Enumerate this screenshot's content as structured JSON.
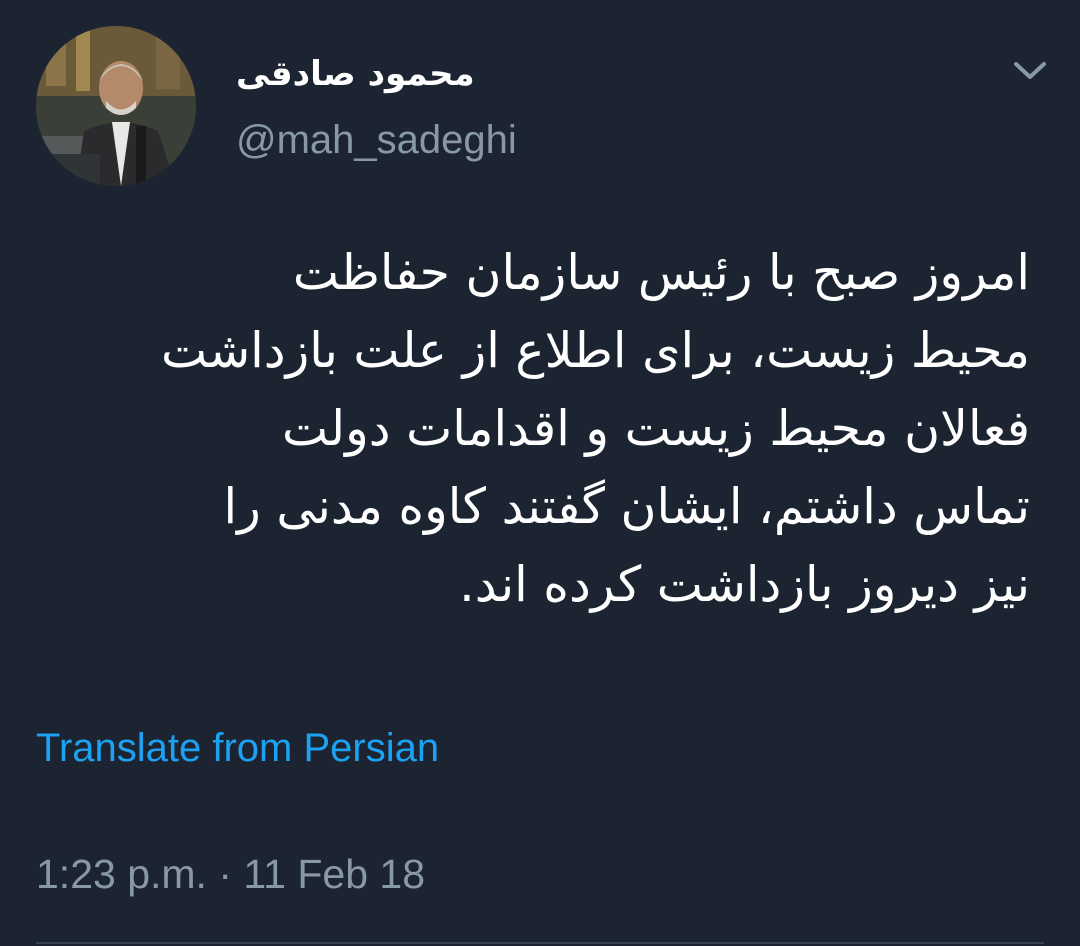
{
  "author": {
    "display_name": "محمود صادقی",
    "handle": "@mah_sadeghi",
    "avatar_icon": "profile-photo-avatar"
  },
  "menu": {
    "icon": "chevron-down-icon"
  },
  "tweet": {
    "lines": [
      "امروز صبح با رئیس سازمان حفاظت",
      "محیط زیست، برای اطلاع از علت بازداشت",
      "فعالان محیط زیست و اقدامات دولت",
      "تماس داشتم، ایشان گفتند کاوه مدنی را",
      "نیز دیروز بازداشت کرده اند."
    ],
    "translate_label": "Translate from Persian",
    "time": "1:23 p.m.",
    "separator": "·",
    "date": "11 Feb 18"
  },
  "colors": {
    "background": "#1b2430",
    "text": "#ffffff",
    "secondary": "#8899a6",
    "link": "#1da1f2"
  }
}
